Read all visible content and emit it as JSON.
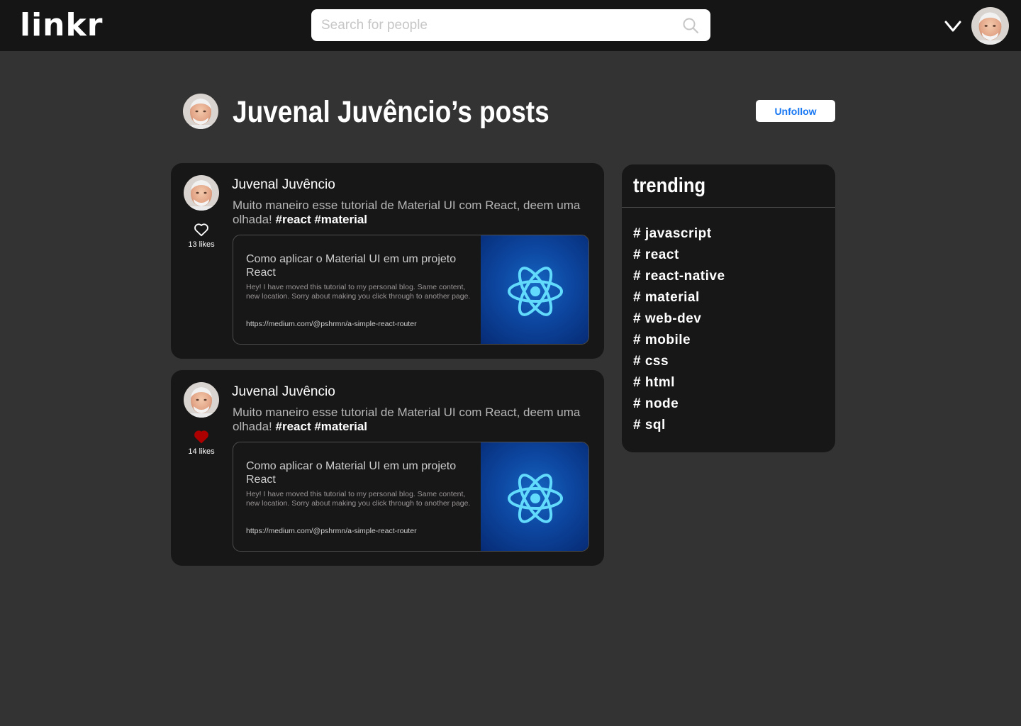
{
  "header": {
    "logo": "linkr",
    "search_placeholder": "Search for people"
  },
  "profile": {
    "title": "Juvenal Juvêncio’s posts",
    "unfollow_label": "Unfollow"
  },
  "posts": [
    {
      "author": "Juvenal Juvêncio",
      "text": "Muito maneiro esse tutorial de Material UI com React, deem uma olhada!",
      "tags": "#react #material",
      "liked": false,
      "likes": "13 likes",
      "link": {
        "title": "Como aplicar o Material UI em um projeto React",
        "description": "Hey! I have moved this tutorial to my personal blog. Same content, new location. Sorry about making you click through to another page.",
        "url": "https://medium.com/@pshrmn/a-simple-react-router"
      }
    },
    {
      "author": "Juvenal Juvêncio",
      "text": "Muito maneiro esse tutorial de Material UI com React, deem uma olhada!",
      "tags": "#react #material",
      "liked": true,
      "likes": "14 likes",
      "link": {
        "title": "Como aplicar o Material UI em um projeto React",
        "description": "Hey! I have moved this tutorial to my personal blog. Same content, new location. Sorry about making you click through to another page.",
        "url": "https://medium.com/@pshrmn/a-simple-react-router"
      }
    }
  ],
  "trending": {
    "title": "trending",
    "tags": [
      "# javascript",
      "# react",
      "# react-native",
      "# material",
      "# web-dev",
      "# mobile",
      "# css",
      "# html",
      "# node",
      "# sql"
    ]
  },
  "colors": {
    "background": "#333333",
    "header": "#151515",
    "card": "#171717",
    "accent": "#1877f2",
    "liked": "#ac0000"
  }
}
